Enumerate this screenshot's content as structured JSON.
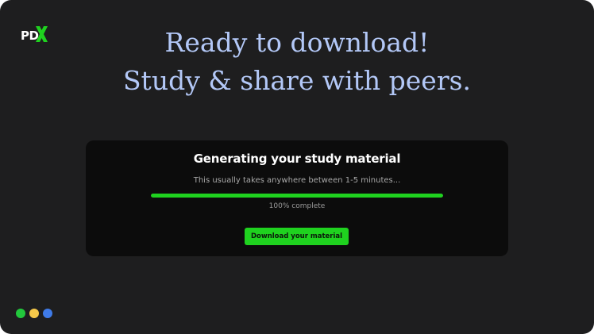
{
  "brand": {
    "logo_text": "PD",
    "logo_mark_icon": "x-mark-icon",
    "accent_color": "#1fd21f"
  },
  "heading": {
    "line1": "Ready to download!",
    "line2": "Study & share with peers.",
    "color": "#b3c8f7"
  },
  "card": {
    "title": "Generating your study material",
    "subtitle": "This usually takes anywhere between 1-5 minutes...",
    "progress_percent": 100,
    "progress_label": "100% complete",
    "button_label": "Download your material"
  },
  "indicator_dots": [
    {
      "name": "green-dot",
      "color": "#22c83c"
    },
    {
      "name": "yellow-dot",
      "color": "#f5c84a"
    },
    {
      "name": "blue-dot",
      "color": "#3f7be8"
    }
  ]
}
